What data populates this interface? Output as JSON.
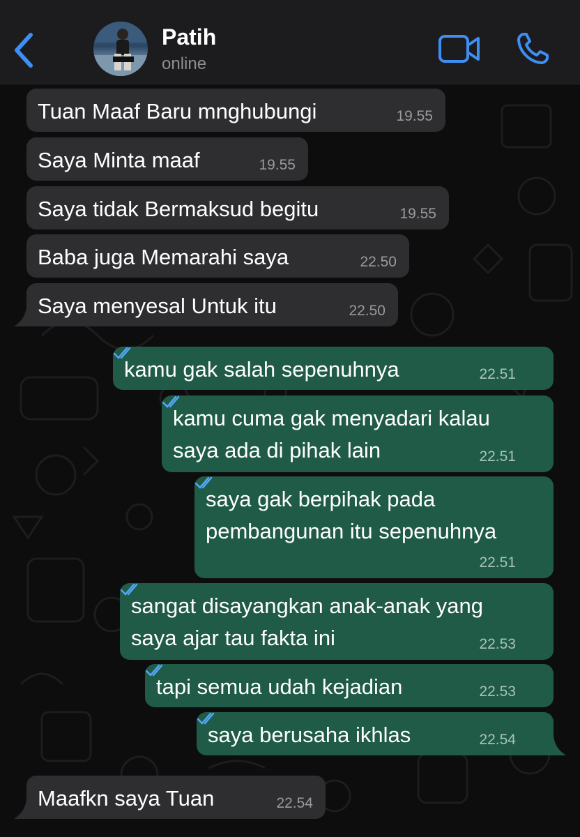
{
  "header": {
    "contact_name": "Patih",
    "status": "online",
    "accent_color": "#3d8ef5",
    "back_icon": "chevron-left-icon",
    "video_icon": "video-camera-icon",
    "call_icon": "phone-icon"
  },
  "messages": [
    {
      "direction": "incoming",
      "text": "Tuan Maaf Baru mnghubungi",
      "time": "19.55"
    },
    {
      "direction": "incoming",
      "text": "Saya Minta maaf",
      "time": "19.55"
    },
    {
      "direction": "incoming",
      "text": "Saya tidak Bermaksud begitu",
      "time": "19.55"
    },
    {
      "direction": "incoming",
      "text": "Baba juga Memarahi saya",
      "time": "22.50"
    },
    {
      "direction": "incoming",
      "text": "Saya menyesal Untuk itu",
      "time": "22.50"
    },
    {
      "direction": "outgoing",
      "text": "kamu gak salah sepenuhnya",
      "time": "22.51",
      "status": "read"
    },
    {
      "direction": "outgoing",
      "lines": [
        "kamu cuma gak menyadari kalau",
        "saya ada di pihak lain"
      ],
      "time": "22.51",
      "status": "read"
    },
    {
      "direction": "outgoing",
      "lines": [
        "saya gak berpihak pada",
        "pembangunan itu sepenuhnya"
      ],
      "time": "22.51",
      "status": "read"
    },
    {
      "direction": "outgoing",
      "lines": [
        "sangat disayangkan anak-anak yang",
        "saya ajar tau fakta ini"
      ],
      "time": "22.53",
      "status": "read"
    },
    {
      "direction": "outgoing",
      "text": "tapi semua udah kejadian",
      "time": "22.53",
      "status": "read"
    },
    {
      "direction": "outgoing",
      "text": "saya berusaha ikhlas",
      "time": "22.54",
      "status": "read"
    },
    {
      "direction": "incoming",
      "text": "Maafkn saya Tuan",
      "time": "22.54"
    }
  ],
  "colors": {
    "incoming_bubble": "#2e2e30",
    "outgoing_bubble": "#1f5b46",
    "read_tick": "#53a6f5"
  }
}
